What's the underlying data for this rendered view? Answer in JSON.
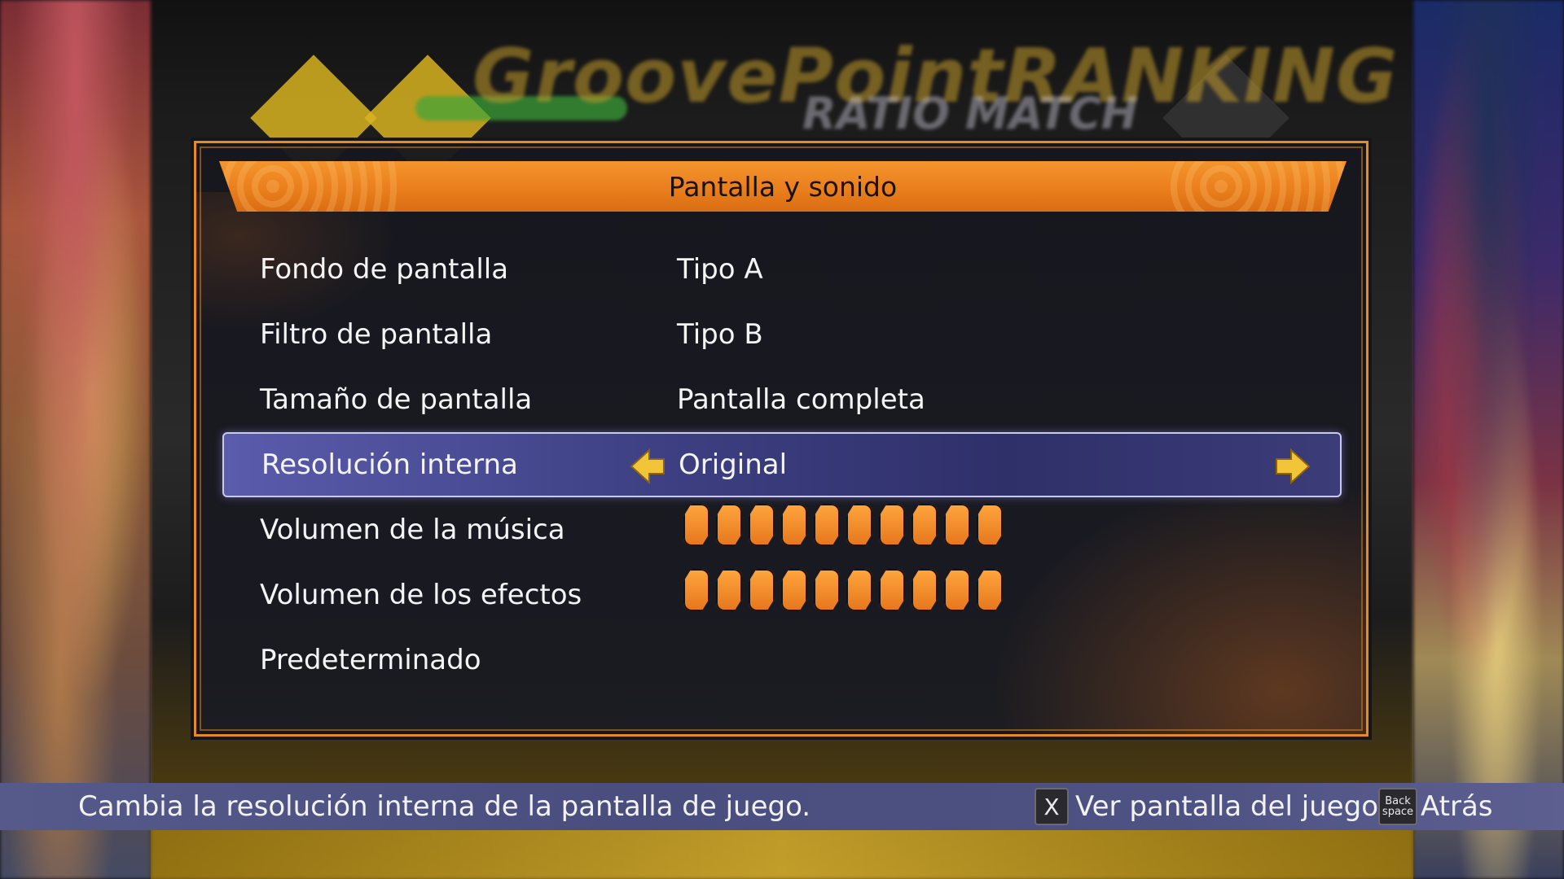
{
  "background": {
    "title_text": "GroovePointRANKING",
    "subtitle_text": "RATIO MATCH"
  },
  "panel": {
    "title": "Pantalla y sonido",
    "accent_color": "#e88a24",
    "rows": [
      {
        "label": "Fondo de pantalla",
        "value": "Tipo A"
      },
      {
        "label": "Filtro de pantalla",
        "value": "Tipo B"
      },
      {
        "label": "Tamaño de pantalla",
        "value": "Pantalla completa"
      },
      {
        "label": "Resolución interna",
        "value": "Original",
        "selected": true
      },
      {
        "label": "Volumen de la música",
        "level": 10,
        "max": 10
      },
      {
        "label": "Volumen de los efectos",
        "level": 10,
        "max": 10
      },
      {
        "label": "Predeterminado"
      }
    ]
  },
  "help_bar": {
    "description": "Cambia la resolución interna de la pantalla de juego.",
    "hints": [
      {
        "key": "X",
        "label": "Ver pantalla del juego"
      },
      {
        "key": "Back space",
        "label": "Atrás"
      }
    ]
  }
}
